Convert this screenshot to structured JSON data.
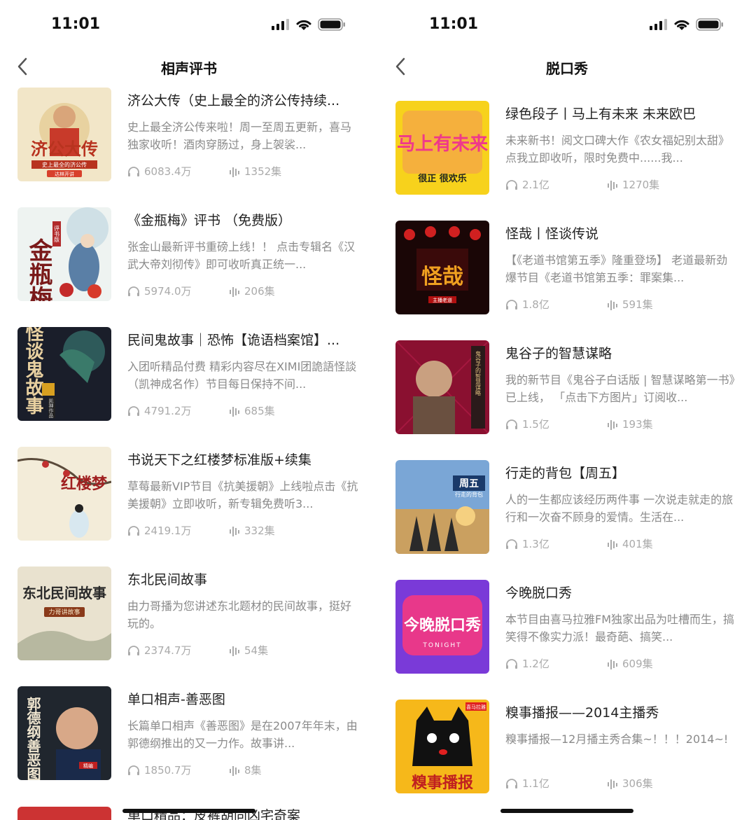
{
  "left": {
    "status": {
      "time": "11:01"
    },
    "nav": {
      "title": "相声评书"
    },
    "items": [
      {
        "title": "济公大传（史上最全的济公传持续...",
        "desc": "史上最全济公传来啦！周一至周五更新，喜马独家收听！酒肉穿肠过，身上袈裟...",
        "plays": "6083.4万",
        "episodes": "1352集",
        "cover_text": "济公大传",
        "cover_sub": "史上最全的济公传",
        "cover_tag": "达林开讲"
      },
      {
        "title": "《金瓶梅》评书 （免费版）",
        "desc": "张金山最新评书重磅上线！！ 点击专辑名《汉武大帝刘彻传》即可收听真正统一...",
        "plays": "5974.0万",
        "episodes": "206集",
        "cover_text": "金瓶梅",
        "cover_sub": "评书版"
      },
      {
        "title": "民间鬼故事｜恐怖【诡语档案馆】...",
        "desc": "入团听精品付费 精彩内容尽在XIMI团詭語怪談（凯神成名作）节目每日保持不间...",
        "plays": "4791.2万",
        "episodes": "685集",
        "cover_text": "怪谈鬼故事",
        "cover_sub": "凯神作品"
      },
      {
        "title": "书说天下之红楼梦标准版+续集",
        "desc": "草莓最新VIP节目《抗美援朝》上线啦点击《抗美援朝》立即收听，新专辑免费听3...",
        "plays": "2419.1万",
        "episodes": "332集",
        "cover_text": "红楼梦"
      },
      {
        "title": "东北民间故事",
        "desc": "由力哥播为您讲述东北题材的民间故事，挺好玩的。",
        "plays": "2374.7万",
        "episodes": "54集",
        "cover_text": "东北民间故事",
        "cover_sub": "力哥讲故事"
      },
      {
        "title": "单口相声-善恶图",
        "desc": "长篇单口相声《善恶图》是在2007年年末，由郭德纲推出的又一力作。故事讲...",
        "plays": "1850.7万",
        "episodes": "8集",
        "cover_text": "郭德纲善恶图",
        "cover_sub": "精编"
      }
    ],
    "peek_title": "单口精品：皮裤胡同凶宅奇案"
  },
  "right": {
    "status": {
      "time": "11:01"
    },
    "nav": {
      "title": "脱口秀"
    },
    "items": [
      {
        "title": "绿色段子丨马上有未来 未来欧巴",
        "desc": "未来新书！阅文口碑大作《农女福妃别太甜》点我立即收听，限时免费中......我...",
        "plays": "2.1亿",
        "episodes": "1270集",
        "cover_text": "马上有未来",
        "cover_sub": "很正 很欢乐"
      },
      {
        "title": "怪哉丨怪谈传说",
        "desc": "【《老道书馆第五季》隆重登场】 老道最新劲爆节目《老道书馆第五季：罪案集...",
        "plays": "1.8亿",
        "episodes": "591集",
        "cover_text": "怪哉",
        "cover_sub": "主播老道"
      },
      {
        "title": "鬼谷子的智慧谋略",
        "desc": "我的新节目《鬼谷子白话版 | 智慧谋略第一书》已上线， 「点击下方图片」订阅收...",
        "plays": "1.5亿",
        "episodes": "193集",
        "cover_text": "鬼谷子的智慧谋略"
      },
      {
        "title": "行走的背包【周五】",
        "desc": "人的一生都应该经历两件事 一次说走就走的旅行和一次奋不顾身的爱情。生活在...",
        "plays": "1.3亿",
        "episodes": "401集",
        "cover_text": "周五",
        "cover_sub": "行走的背包"
      },
      {
        "title": "今晚脱口秀",
        "desc": "本节目由喜马拉雅FM独家出品为吐槽而生，搞笑得不像实力派！最奇葩、搞笑...",
        "plays": "1.2亿",
        "episodes": "609集",
        "cover_text": "今晚脱口秀",
        "cover_sub": "TONIGHT"
      },
      {
        "title": "糗事播报——2014主播秀",
        "desc": "糗事播报—12月播主秀合集~！！！2014~!",
        "plays": "1.1亿",
        "episodes": "306集",
        "cover_text": "糗事播报",
        "cover_sub": "喜马拉雅"
      }
    ]
  },
  "colors": {
    "accent": "#111111",
    "meta": "#aaaaaa",
    "desc": "#8a8a8a"
  }
}
